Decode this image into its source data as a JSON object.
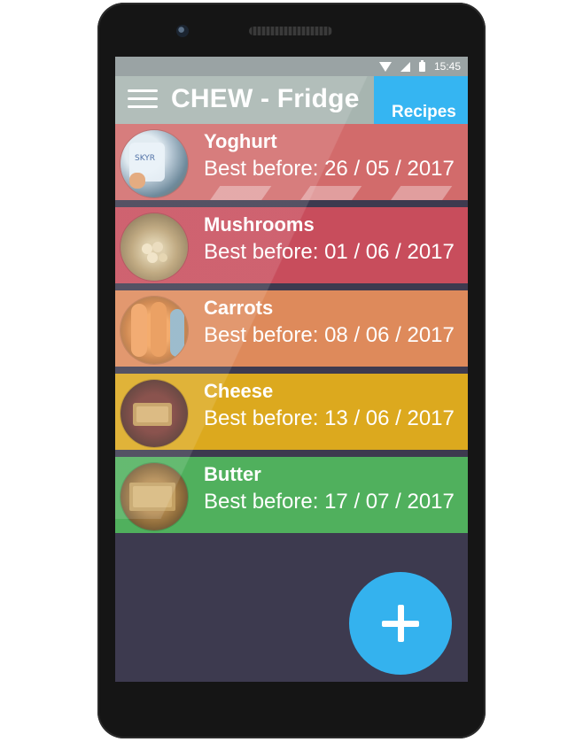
{
  "status_bar": {
    "time": "15:45",
    "icons": [
      "wifi-icon",
      "signal-icon",
      "battery-icon"
    ]
  },
  "app_bar": {
    "title": "CHEW - Fridge",
    "menu_icon": "hamburger-menu-icon"
  },
  "recipes_button": {
    "label": "Recipes",
    "color": "#35b5f2"
  },
  "items": [
    {
      "name": "Yoghurt",
      "date": "Best before: 26 / 05 / 2017",
      "color": "#d26b6b"
    },
    {
      "name": "Mushrooms",
      "date": "Best before: 01 / 06 / 2017",
      "color": "#c84d5c"
    },
    {
      "name": "Carrots",
      "date": "Best before: 08 / 06 / 2017",
      "color": "#de8a5b"
    },
    {
      "name": "Cheese",
      "date": "Best before: 13 / 06 / 2017",
      "color": "#dca91e"
    },
    {
      "name": "Butter",
      "date": "Best before: 17 / 07 / 2017",
      "color": "#50b05d"
    }
  ],
  "fab": {
    "icon": "plus-icon",
    "color": "#34b2ee"
  },
  "colors": {
    "background": "#3d3a4f",
    "app_bar": "#a7b5b0",
    "status_bar": "#9aa3a4"
  }
}
